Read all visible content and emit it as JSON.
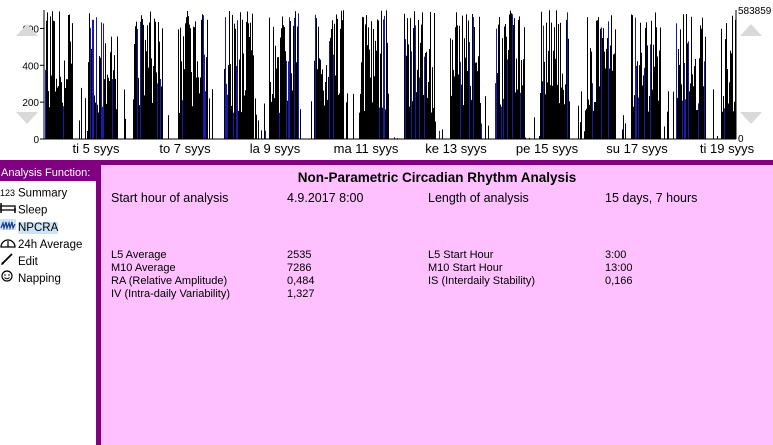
{
  "chart": {
    "y_ticks": [
      "600",
      "400",
      "200",
      "0"
    ],
    "y_tick_values": [
      600,
      400,
      200,
      0
    ],
    "y_max": 700,
    "right_top_label": "583859",
    "right_bottom_label": "0",
    "day_labels": [
      "ti 5 syys",
      "to 7 syys",
      "la 9 syys",
      "ma 11 syys",
      "ke 13 syys",
      "pe 15 syys",
      "su 17 syys",
      "ti 19 syys"
    ],
    "bar_color": "#000000",
    "marker_color": "#1a1aa8"
  },
  "sidebar": {
    "title": "Analysis Function:",
    "items": [
      {
        "icon": "123",
        "label": "Summary",
        "selected": false
      },
      {
        "icon": "bed",
        "label": "Sleep",
        "selected": false
      },
      {
        "icon": "npcra",
        "label": "NPCRA",
        "selected": true
      },
      {
        "icon": "24h",
        "label": "24h Average",
        "selected": false
      },
      {
        "icon": "pencil",
        "label": "Edit",
        "selected": false
      },
      {
        "icon": "smiley",
        "label": "Napping",
        "selected": false
      }
    ]
  },
  "main": {
    "title": "Non-Parametric Circadian Rhythm Analysis",
    "start_label": "Start hour of analysis",
    "start_value": "4.9.2017 8:00",
    "length_label": "Length of analysis",
    "length_value": "15 days, 7 hours",
    "left_metrics": [
      {
        "label": "L5 Average",
        "value": "2535"
      },
      {
        "label": "M10 Average",
        "value": "7286"
      },
      {
        "label": "RA (Relative Amplitude)",
        "value": "0,484"
      },
      {
        "label": "IV (Intra-daily Variability)",
        "value": "1,327"
      }
    ],
    "right_metrics": [
      {
        "label": "L5 Start Hour",
        "value": "3:00"
      },
      {
        "label": "M10 Start Hour",
        "value": "13:00"
      },
      {
        "label": "IS (Interdaily Stability)",
        "value": "0,166"
      }
    ]
  },
  "colors": {
    "accent_purple": "#800080",
    "panel_pink": "#ffc0ff",
    "selection_blue": "#cfe3f7"
  }
}
